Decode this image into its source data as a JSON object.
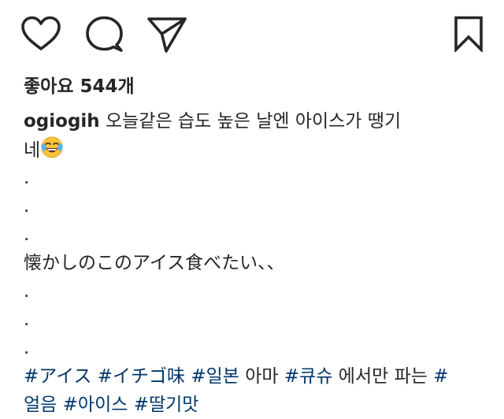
{
  "actions": {
    "like_icon": "heart-outline",
    "comment_icon": "speech-bubble-outline",
    "share_icon": "paper-plane-outline",
    "save_icon": "bookmark-outline"
  },
  "likes": {
    "label": "좋아요",
    "count": "544개"
  },
  "caption": {
    "username": "ogiogih",
    "text_line1": " 오늘같은 습도 높은 날엔 아이스가 땡기",
    "text_line2": "네",
    "emoji": "face-with-tears-of-joy",
    "dot1": ".",
    "dot2": ".",
    "dot3": ".",
    "japanese": "懐かしのこのアイス食べたい、、",
    "dot4": ".",
    "dot5": ".",
    "dot6": ".",
    "tags_line1": [
      {
        "text": "#アイス",
        "tag": true
      },
      {
        "text": " ",
        "tag": false
      },
      {
        "text": "#イチゴ味",
        "tag": true
      },
      {
        "text": " ",
        "tag": false
      },
      {
        "text": "#일본",
        "tag": true
      },
      {
        "text": " 아마 ",
        "tag": false
      },
      {
        "text": "#큐슈",
        "tag": true
      },
      {
        "text": " 에서만 파는 ",
        "tag": false
      },
      {
        "text": "#",
        "tag": true
      }
    ],
    "tags_line2": [
      {
        "text": "얼음",
        "tag": true
      },
      {
        "text": " ",
        "tag": false
      },
      {
        "text": "#아이스",
        "tag": true
      },
      {
        "text": " ",
        "tag": false
      },
      {
        "text": "#딸기맛",
        "tag": true
      }
    ]
  },
  "colors": {
    "text": "#262626",
    "hashtag": "#00376b",
    "background": "#ffffff"
  }
}
